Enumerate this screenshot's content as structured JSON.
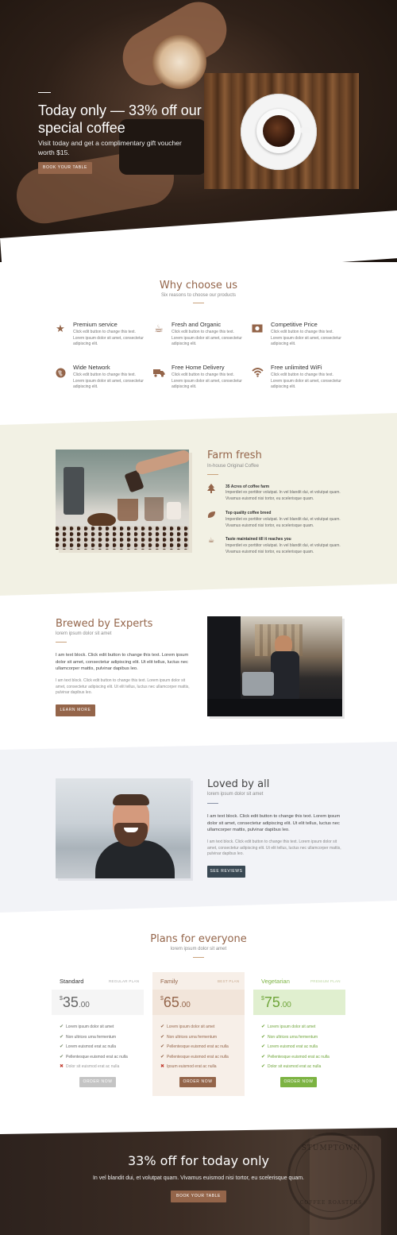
{
  "colors": {
    "accent": "#94654a",
    "farm_bg": "#f2f1e4",
    "loved_bg": "#f2f3f7",
    "dark_button": "#394853",
    "vegetarian_green": "#7cb342",
    "vegetarian_light": "#e0efcf",
    "family_bg": "#f7efe8",
    "gray_button": "#c4c4c4"
  },
  "hero": {
    "title": "Today only — 33% off our special coffee",
    "subtitle": "Visit today and get a complimentary gift voucher worth $15.",
    "button": "BOOK YOUR TABLE"
  },
  "why": {
    "title": "Why choose us",
    "subtitle": "Six reasons to choose our products",
    "features": [
      {
        "icon": "star-icon",
        "title": "Premium service",
        "text": "Click edit button to change this text. Lorem ipsum dolor sit amet, consectetur adipiscing elit."
      },
      {
        "icon": "coffee-cup-icon",
        "title": "Fresh and Organic",
        "text": "Click edit button to change this text. Lorem ipsum dolor sit amet, consectetur adipiscing elit."
      },
      {
        "icon": "money-icon",
        "title": "Competitive Price",
        "text": "Click edit button to change this text. Lorem ipsum dolor sit amet, consectetur adipiscing elit."
      },
      {
        "icon": "globe-icon",
        "title": "Wide Network",
        "text": "Click edit button to change this text. Lorem ipsum dolor sit amet, consectetur adipiscing elit."
      },
      {
        "icon": "truck-icon",
        "title": "Free Home Delivery",
        "text": "Click edit button to change this text. Lorem ipsum dolor sit amet, consectetur adipiscing elit."
      },
      {
        "icon": "wifi-icon",
        "title": "Free unlimited WiFi",
        "text": "Click edit button to change this text. Lorem ipsum dolor sit amet, consectetur adipiscing elit."
      }
    ]
  },
  "farm": {
    "title": "Farm fresh",
    "subtitle": "In-house Original Coffee",
    "items": [
      {
        "icon": "tree-icon",
        "title": "35 Acres of coffee farm",
        "text": "Imperdiet ex porttitor volutpat. In vel blandit dui, et volutpat quam. Vivamus euismod nisi tortor, eu scelerisque quam."
      },
      {
        "icon": "leaf-icon",
        "title": "Top quality coffee breed",
        "text": "Imperdiet ex porttitor volutpat. In vel blandit dui, et volutpat quam. Vivamus euismod nisi tortor, eu scelerisque quam."
      },
      {
        "icon": "coffee-cup-icon",
        "title": "Taste maintained till it reaches you",
        "text": "Imperdiet ex porttitor volutpat. In vel blandit dui, et volutpat quam. Vivamus euismod nisi tortor, eu scelerisque quam."
      }
    ]
  },
  "brewed": {
    "title": "Brewed by Experts",
    "subtitle": "lorem ipsum dolor sit amet",
    "text_strong": "I am text block. Click edit button to change this text. Lorem ipsum dolor sit amet, consectetur adipiscing elit. Ut elit tellus, luctus nec ullamcorper mattis, pulvinar dapibus leo.",
    "text_light": "I am text block. Click edit button to change this text. Lorem ipsum dolor sit amet, consectetur adipiscing elit. Ut elit tellus, luctus nec ullamcorper mattis, pulvinar dapibus leo.",
    "button": "LEARN MORE"
  },
  "loved": {
    "title": "Loved by all",
    "subtitle": "lorem ipsum dolor sit amet",
    "text_strong": "I am text block. Click edit button to change this text. Lorem ipsum dolor sit amet, consectetur adipiscing elit. Ut elit tellus, luctus nec ullamcorper mattis, pulvinar dapibus leo.",
    "text_light": "I am text block. Click edit button to change this text. Lorem ipsum dolor sit amet, consectetur adipiscing elit. Ut elit tellus, luctus nec ullamcorper mattis, pulvinar dapibus leo.",
    "button": "SEE REVIEWS"
  },
  "plans": {
    "title": "Plans for everyone",
    "subtitle": "lorem ipsum dolor sit amet",
    "cards": [
      {
        "name": "Standard",
        "tag": "REGULAR PLAN",
        "currency": "$",
        "amount": "35",
        "cents": ".00",
        "features": [
          "Lorem ipsum dolor sit amet",
          "Non ultrices urna fermentum",
          "Lorem euismod erat ac nulla",
          "Pellentesque euismod erat ac nulla",
          "Dolor sit euismod erat ac nulla"
        ],
        "button": "ORDER NOW"
      },
      {
        "name": "Family",
        "tag": "BEST PLAN",
        "currency": "$",
        "amount": "65",
        "cents": ".00",
        "features": [
          "Lorem ipsum dolor sit amet",
          "Non ultrices urna fermentum",
          "Pellentesque euismod erat ac nulla",
          "Pellentesque euismod erat ac nulla",
          "Ipsum euismod erat ac nulla"
        ],
        "button": "ORDER NOW"
      },
      {
        "name": "Vegetarian",
        "tag": "PREMIUM PLAN",
        "currency": "$",
        "amount": "75",
        "cents": ".00",
        "features": [
          "Lorem ipsum dolor sit amet",
          "Non ultrices urna fermentum",
          "Lorem euismod erat ac nulla",
          "Pellentesque euismod erat ac nulla",
          "Dolor sit euismod erat ac nulla"
        ],
        "button": "ORDER NOW"
      }
    ]
  },
  "cta": {
    "title": "33% off for today only",
    "subtitle": "In vel blandit dui, et volutpat quam. Vivamus euismod nisi tortor, eu scelerisque quam.",
    "button": "BOOK YOUR TABLE",
    "stamp_top": "STUMPTOWN",
    "stamp_bottom": "COFFEE ROASTERS"
  }
}
